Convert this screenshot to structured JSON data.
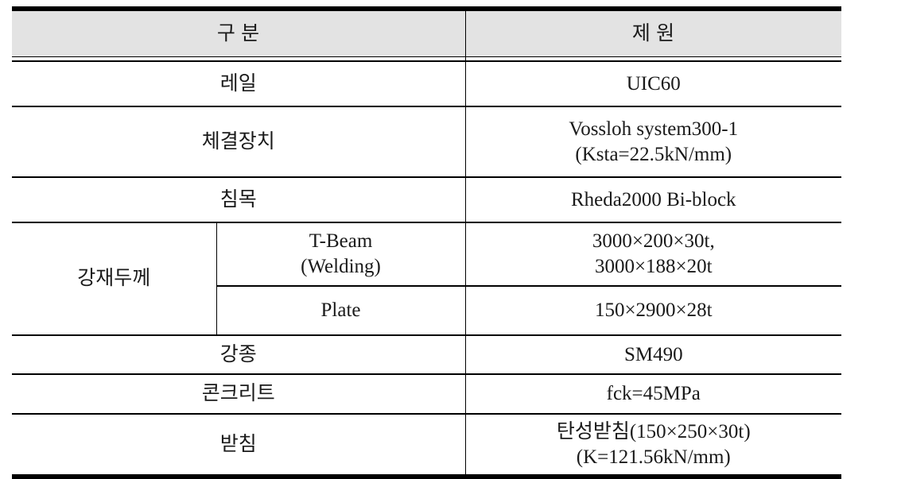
{
  "table": {
    "headers": {
      "category": "구  분",
      "spec": "제  원"
    },
    "header_bg": "#e3e3e3",
    "border_color": "#000000",
    "rows": [
      {
        "label": "레일",
        "value": "UIC60"
      },
      {
        "label": "체결장치",
        "value_line1": "Vossloh system300-1",
        "value_line2": "(Ksta=22.5kN/mm)"
      },
      {
        "label": "침목",
        "value": "Rheda2000 Bi-block"
      },
      {
        "group_label": "강재두께",
        "sub_label_line1": "T-Beam",
        "sub_label_line2": "(Welding)",
        "value_line1": "3000×200×30t,",
        "value_line2": "3000×188×20t"
      },
      {
        "sub_label": "Plate",
        "value": "150×2900×28t"
      },
      {
        "label": "강종",
        "value": "SM490"
      },
      {
        "label": "콘크리트",
        "value": "fck=45MPa"
      },
      {
        "label": "받침",
        "value_line1": "탄성받침(150×250×30t)",
        "value_line2": "(K=121.56kN/mm)"
      }
    ]
  }
}
